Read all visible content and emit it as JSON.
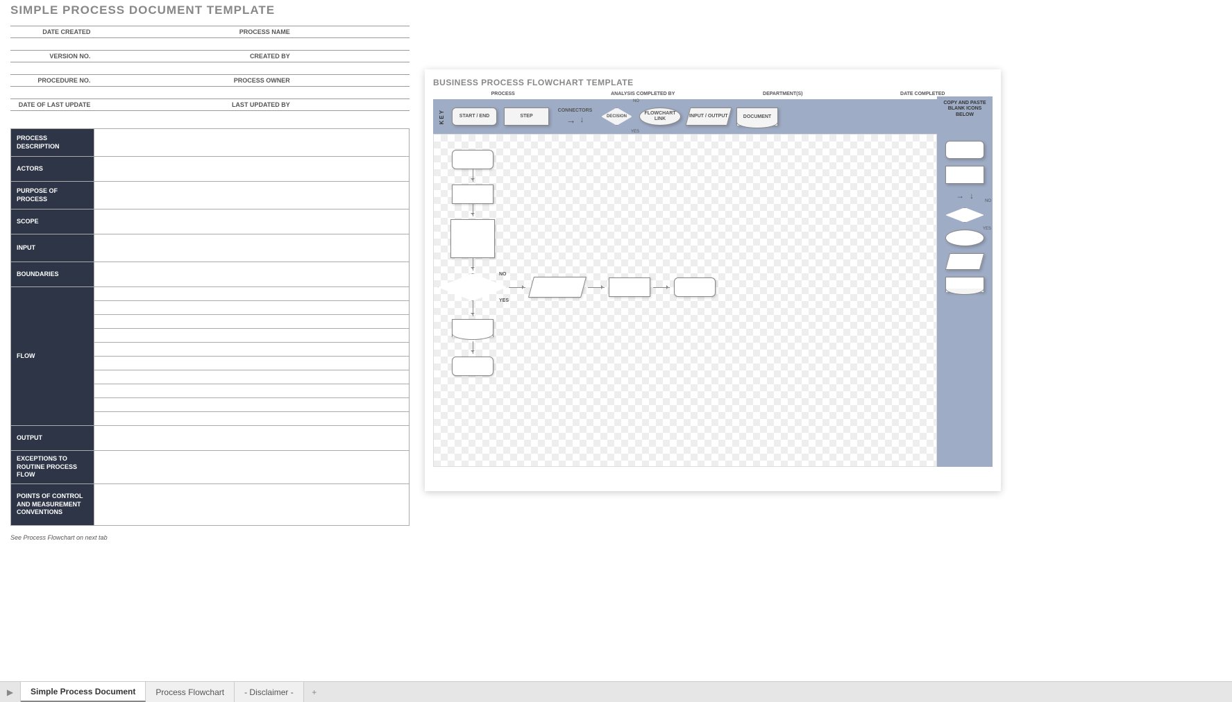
{
  "doc": {
    "title": "SIMPLE PROCESS DOCUMENT TEMPLATE",
    "header": {
      "date_created": "DATE CREATED",
      "process_name": "PROCESS NAME",
      "version_no": "VERSION NO.",
      "created_by": "CREATED BY",
      "procedure_no": "PROCEDURE NO.",
      "process_owner": "PROCESS OWNER",
      "date_last_update": "DATE OF LAST UPDATE",
      "last_updated_by": "LAST UPDATED BY"
    },
    "rows": {
      "process_description": "PROCESS DESCRIPTION",
      "actors": "ACTORS",
      "purpose": "PURPOSE OF PROCESS",
      "scope": "SCOPE",
      "input": "INPUT",
      "boundaries": "BOUNDARIES",
      "flow": "FLOW",
      "output": "OUTPUT",
      "exceptions": "EXCEPTIONS TO ROUTINE PROCESS FLOW",
      "points": "POINTS OF CONTROL AND MEASUREMENT CONVENTIONS"
    },
    "footnote": "See Process Flowchart on next tab"
  },
  "flow": {
    "title": "BUSINESS PROCESS FLOWCHART TEMPLATE",
    "hdr": {
      "process": "PROCESS",
      "analysis": "ANALYSIS COMPLETED BY",
      "departments": "DEPARTMENT(S)",
      "date_completed": "DATE COMPLETED"
    },
    "key": {
      "label": "KEY",
      "start_end": "START / END",
      "step": "STEP",
      "connectors": "CONNECTORS",
      "decision": "DECISION",
      "no": "NO",
      "yes": "YES",
      "flowchart_link": "FLOWCHART LINK",
      "input_output": "INPUT / OUTPUT",
      "document": "DOCUMENT",
      "copy_paste": "COPY AND PASTE BLANK ICONS BELOW"
    },
    "canvas": {
      "no": "NO",
      "yes": "YES"
    }
  },
  "tabs": {
    "t1": "Simple Process Document",
    "t2": "Process Flowchart",
    "t3": "- Disclaimer -",
    "add": "+",
    "nav": "▶"
  }
}
